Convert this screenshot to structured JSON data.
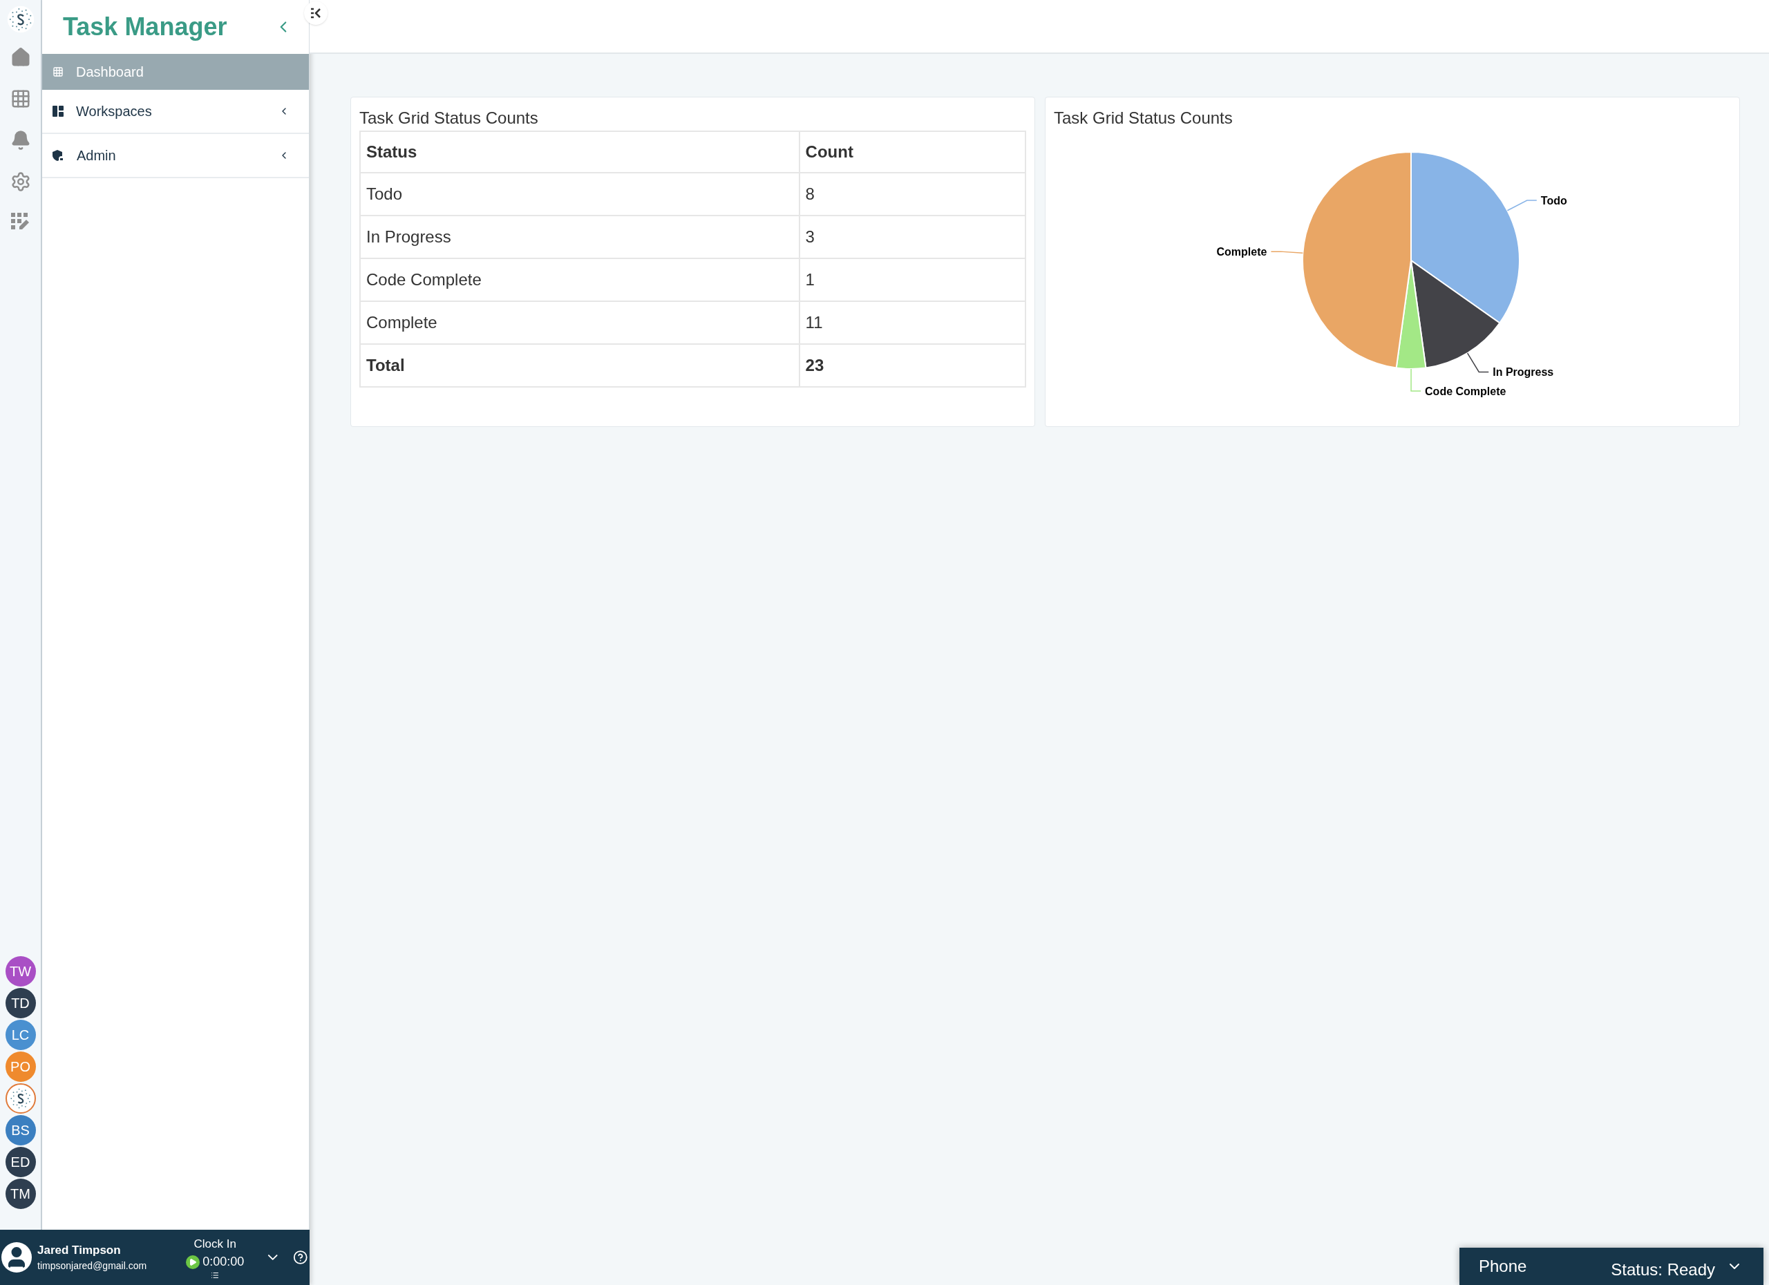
{
  "app_title": "Task Manager",
  "nav": [
    {
      "label": "Dashboard",
      "selected": true,
      "expandable": false
    },
    {
      "label": "Workspaces",
      "selected": false,
      "expandable": true
    },
    {
      "label": "Admin",
      "selected": false,
      "expandable": true
    }
  ],
  "avatars": [
    {
      "kind": "initials",
      "initials": "TW",
      "color": "#a94fc5"
    },
    {
      "kind": "initials",
      "initials": "TD",
      "color": "#2e3e50"
    },
    {
      "kind": "initials",
      "initials": "LC",
      "color": "#4a90d0"
    },
    {
      "kind": "initials",
      "initials": "PO",
      "color": "#ef8a2e"
    },
    {
      "kind": "logo"
    },
    {
      "kind": "initials",
      "initials": "BS",
      "color": "#3b7fc0"
    },
    {
      "kind": "initials",
      "initials": "ED",
      "color": "#2e3e50"
    },
    {
      "kind": "initials",
      "initials": "TM",
      "color": "#2e3e50"
    }
  ],
  "user": {
    "name": "Jared Timpson",
    "email": "timpsonjared@gmail.com"
  },
  "clock": {
    "label": "Clock In",
    "time": "0:00:00"
  },
  "cards": [
    {
      "kind": "table",
      "title": "Task Grid Status Counts",
      "columns": [
        "Status",
        "Count"
      ],
      "rows": [
        {
          "cells": [
            "Todo",
            "8"
          ],
          "bold": false
        },
        {
          "cells": [
            "In Progress",
            "3"
          ],
          "bold": false
        },
        {
          "cells": [
            "Code Complete",
            "1"
          ],
          "bold": false
        },
        {
          "cells": [
            "Complete",
            "11"
          ],
          "bold": false
        },
        {
          "cells": [
            "Total",
            "23"
          ],
          "bold": true
        }
      ]
    },
    {
      "kind": "chart",
      "title": "Task Grid Status Counts",
      "chart_data": {
        "type": "pie",
        "categories": [
          "Todo",
          "In Progress",
          "Code Complete",
          "Complete"
        ],
        "series": [
          {
            "colors": [
              "#88b4e7",
              "#434348",
              "#a3e886",
              "#e9a665"
            ],
            "values": [
              34.78,
              13.04,
              4.35,
              47.83
            ]
          }
        ]
      }
    }
  ],
  "phone": {
    "label": "Phone",
    "status": "Status: Ready"
  }
}
